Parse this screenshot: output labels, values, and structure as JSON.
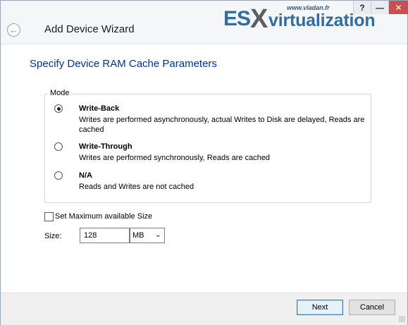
{
  "window": {
    "title": "Add Device Wizard",
    "help_label": "?",
    "minimize_label": "—",
    "close_label": "✕"
  },
  "watermark": {
    "url": "www.vladan.fr",
    "brand_es": "ES",
    "brand_x": "X",
    "brand_rest": "virtualization"
  },
  "page": {
    "heading": "Specify Device RAM Cache Parameters"
  },
  "mode": {
    "legend": "Mode",
    "options": [
      {
        "title": "Write-Back",
        "description": "Writes are performed asynchronously, actual Writes to Disk are delayed, Reads are cached",
        "selected": true
      },
      {
        "title": "Write-Through",
        "description": "Writes are performed synchronously, Reads are cached",
        "selected": false
      },
      {
        "title": "N/A",
        "description": "Reads and Writes are not cached",
        "selected": false
      }
    ]
  },
  "max_size": {
    "checkbox_label": "Set Maximum available Size",
    "checked": false
  },
  "size": {
    "label": "Size:",
    "value": "128",
    "unit": "MB",
    "unit_arrow": "⌄"
  },
  "buttons": {
    "next": "Next",
    "cancel": "Cancel"
  },
  "icons": {
    "back": "back-arrow-icon"
  },
  "colors": {
    "heading": "#003399",
    "brand_blue": "#2f6da5",
    "close": "#c75050"
  }
}
